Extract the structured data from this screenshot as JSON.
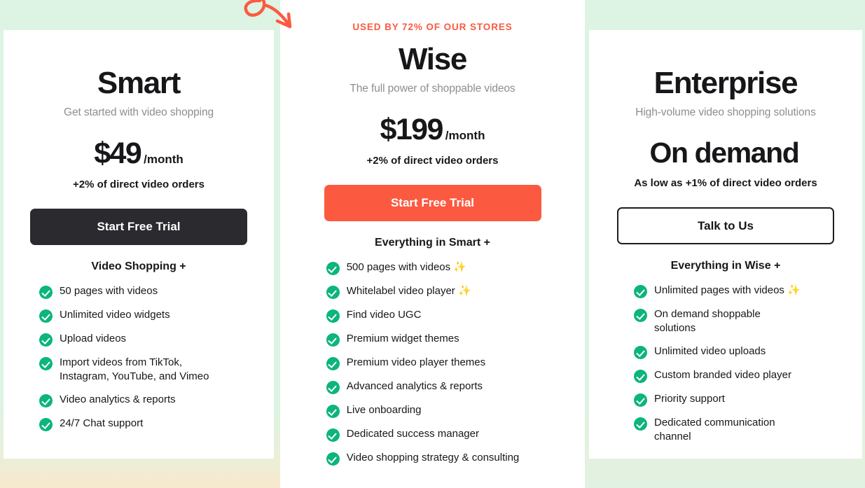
{
  "theme": {
    "background": "#ddf3e4",
    "accent_orange": "#fb5a40",
    "check_green": "#0bb57c",
    "dark": "#2b2b2f",
    "sparkle": "✨"
  },
  "badge": {
    "text": "USED BY 72% OF OUR STORES"
  },
  "doodle": {
    "name": "curly-arrow-doodle",
    "color": "#fb5a40"
  },
  "plans": [
    {
      "id": "smart",
      "name": "Smart",
      "subtitle": "Get started with video shopping",
      "price": "$49",
      "period": "/month",
      "price_note": "+2% of direct video orders",
      "cta_label": "Start Free Trial",
      "cta_style": "dark",
      "features_heading": "Video Shopping +",
      "features": [
        "50 pages with videos",
        "Unlimited video widgets",
        "Upload videos",
        "Import videos from TikTok, Instagram, YouTube, and Vimeo",
        "Video analytics & reports",
        "24/7 Chat support"
      ]
    },
    {
      "id": "wise",
      "name": "Wise",
      "subtitle": "The full power of shoppable videos",
      "price": "$199",
      "period": "/month",
      "price_note": "+2% of direct video orders",
      "cta_label": "Start Free Trial",
      "cta_style": "orange",
      "features_heading": "Everything in Smart +",
      "features": [
        "500 pages with videos ✨",
        "Whitelabel video player ✨",
        "Find video UGC",
        "Premium widget themes",
        "Premium video player themes",
        "Advanced analytics & reports",
        "Live onboarding",
        "Dedicated success manager",
        "Video shopping strategy & consulting"
      ]
    },
    {
      "id": "enterprise",
      "name": "Enterprise",
      "subtitle": "High-volume video shopping solutions",
      "price": "On demand",
      "period": "",
      "price_note": "As low as +1% of direct video orders",
      "cta_label": "Talk to Us",
      "cta_style": "outline",
      "features_heading": "Everything in Wise +",
      "features": [
        "Unlimited pages with videos ✨",
        "On demand shoppable solutions",
        "Unlimited video uploads",
        "Custom branded video player",
        "Priority support",
        "Dedicated communication channel"
      ]
    }
  ]
}
